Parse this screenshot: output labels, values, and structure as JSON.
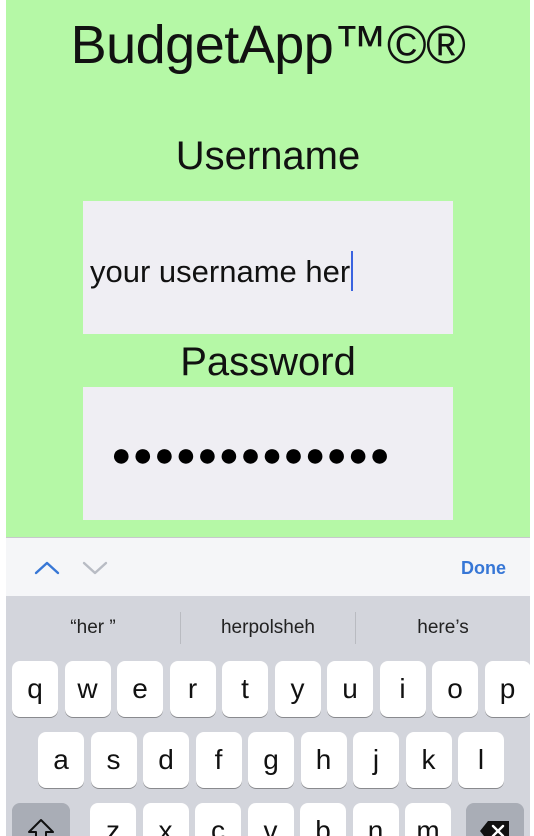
{
  "app": {
    "title": "BudgetApp™©®"
  },
  "form": {
    "username_label": "Username",
    "username_value": "your username her",
    "password_label": "Password",
    "password_mask": "●●●●●●●●●●●●●"
  },
  "keyboard": {
    "done_label": "Done",
    "suggestions": [
      "“her ”",
      "herpolsheh",
      "here’s"
    ],
    "row1": [
      "q",
      "w",
      "e",
      "r",
      "t",
      "y",
      "u",
      "i",
      "o",
      "p"
    ],
    "row2": [
      "a",
      "s",
      "d",
      "f",
      "g",
      "h",
      "j",
      "k",
      "l"
    ],
    "row3": [
      "z",
      "x",
      "c",
      "v",
      "b",
      "n",
      "m"
    ],
    "icons": {
      "prev": "chevron-up-icon",
      "next": "chevron-down-icon",
      "shift": "shift-icon",
      "delete": "delete-icon"
    }
  },
  "colors": {
    "background": "#b5f8a6",
    "field": "#efeef3",
    "accent": "#3777d6",
    "caret": "#3a63e0"
  }
}
